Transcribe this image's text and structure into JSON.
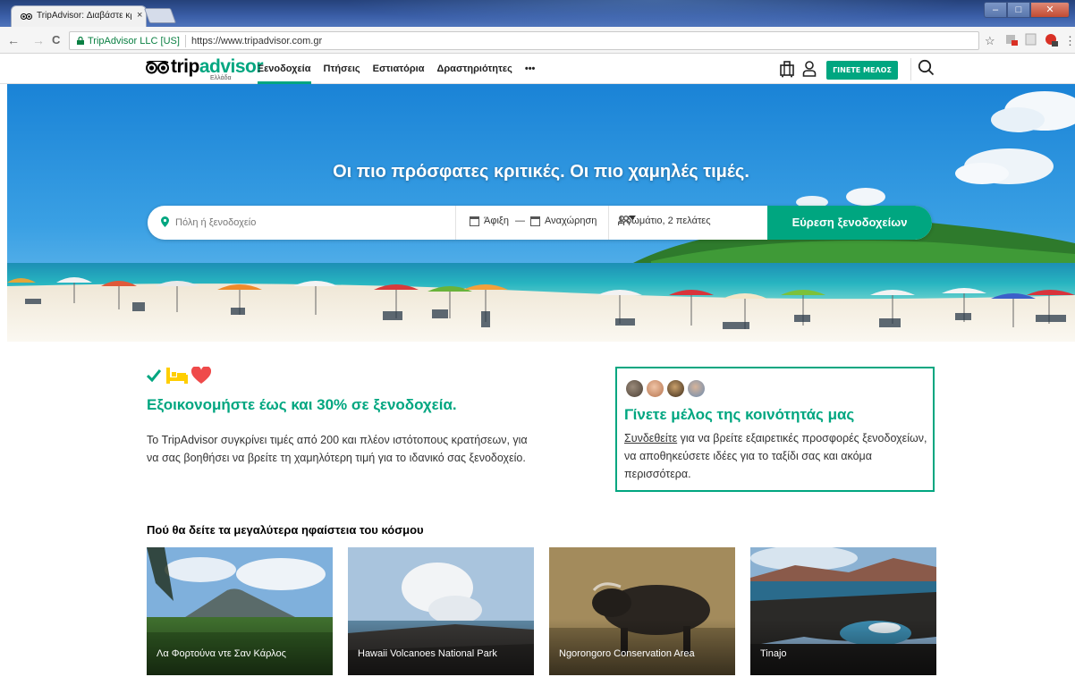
{
  "browser": {
    "tab_title": "TripAdvisor: Διαβάστε κρ",
    "tab_close": "×",
    "secure_label": "TripAdvisor LLC [US]",
    "url": "https://www.tripadvisor.com.gr",
    "back": "←",
    "forward": "→",
    "reload": "C",
    "star": "☆",
    "menu": "⋮"
  },
  "header": {
    "logo_trip": "trip",
    "logo_advisor": "advisor",
    "logo_locale": "Ελλάδα",
    "nav": [
      {
        "label": "Ξενοδοχεία",
        "active": true
      },
      {
        "label": "Πτήσεις"
      },
      {
        "label": "Εστιατόρια"
      },
      {
        "label": "Δραστηριότητες"
      },
      {
        "label": "•••"
      }
    ],
    "join_button": "ΓΙΝΕΤΕ ΜΕΛΟΣ",
    "accent": "#00a680"
  },
  "hero": {
    "title": "Οι πιο πρόσφατες κριτικές. Οι πιο χαμηλές τιμές.",
    "search_placeholder": "Πόλη ή ξενοδοχείο",
    "checkin": "Άφιξη",
    "dash": "—",
    "checkout": "Αναχώρηση",
    "guests": "1 δωμάτιο, 2 πελάτες",
    "find_button": "Εύρεση ξενοδοχείων"
  },
  "promo": {
    "title": "Εξοικονομήστε έως και 30% σε ξενοδοχεία.",
    "text": "Το TripAdvisor συγκρίνει τιμές από 200 και πλέον ιστότοπους κρατήσεων, για να σας βοηθήσει να βρείτε τη χαμηλότερη τιμή για το ιδανικό σας ξενοδοχείο."
  },
  "community": {
    "title": "Γίνετε μέλος της κοινότητάς μας",
    "link": "Συνδεθείτε",
    "text": " για να βρείτε εξαιρετικές προσφορές ξενοδοχείων, να αποθηκεύσετε ιδέες για το ταξίδι σας και ακόμα περισσότερα."
  },
  "volcanoes": {
    "title": "Πού θα δείτε τα μεγαλύτερα ηφαίστεια του κόσμου",
    "cards": [
      {
        "label": "Λα Φορτούνα ντε Σαν Κάρλος"
      },
      {
        "label": "Hawaii Volcanoes National Park"
      },
      {
        "label": "Ngorongoro Conservation Area"
      },
      {
        "label": "Tinajo"
      }
    ]
  }
}
